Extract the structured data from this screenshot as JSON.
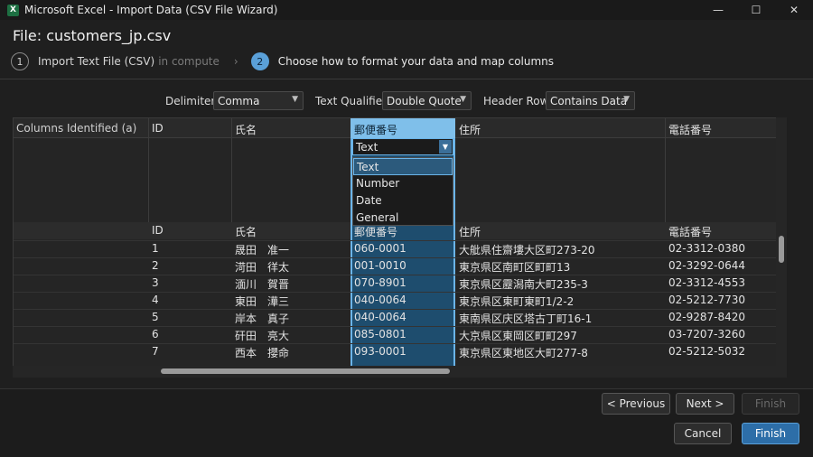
{
  "window": {
    "app_icon_letter": "X",
    "title": "Microsoft Excel - Import Data (CSV File Wizard)",
    "controls": {
      "minimize": "—",
      "maximize": "☐",
      "close": "✕"
    }
  },
  "file": {
    "title": "File: customers_jp.csv"
  },
  "steps": [
    {
      "num": "1",
      "label": "Import Text File (CSV)",
      "sub": "in compute",
      "active": false
    },
    {
      "num": "2",
      "label": "Choose how to format your data and map columns",
      "active": true
    }
  ],
  "step_separator": "›",
  "options": {
    "delimiter_label": "Delimiter:",
    "delimiter_value": "Comma",
    "qualifier_label": "Text Qualifier:",
    "qualifier_value": "Double Quote",
    "header_label": "Header Row:",
    "header_value": "Contains Data"
  },
  "grid": {
    "corner_label": "Columns Identified (a)",
    "columns": [
      "ID",
      "氏名",
      "郵便番号",
      "住所",
      "電話番号"
    ],
    "type_select_value": "Text",
    "type_options": [
      "Text",
      "Number",
      "Date",
      "General"
    ],
    "type_selected": "Text",
    "data_headers": [
      "ID",
      "氏名",
      "郵便番号",
      "住所",
      "電話番号"
    ],
    "rows": [
      [
        "1",
        "晟田　准一",
        "060-0001",
        "大舭県住齋塿大区町273-20",
        "02-3312-0380"
      ],
      [
        "2",
        "渮田　徉太",
        "001-0010",
        "東京県区南町区町町13",
        "02-3292-0644"
      ],
      [
        "3",
        "湎川　賀晋",
        "070-8901",
        "東京県区靂潟南大町235-3",
        "02-3312-4553"
      ],
      [
        "4",
        "東田　澕三",
        "040-0064",
        "東京県区東町東町1/2-2",
        "02-5212-7730"
      ],
      [
        "5",
        "岸本　真子",
        "040-0064",
        "東南県区庆区塔古丁町16-1",
        "02-9287-8420"
      ],
      [
        "6",
        "矸田　亮大",
        "085-0801",
        "大京県区東岡区町町297",
        "03-7207-3260"
      ],
      [
        "7",
        "西本　攖命",
        "093-0001",
        "東京県区東地区大町277-8",
        "02-5212-5032"
      ]
    ]
  },
  "buttons": {
    "previous": "< Previous",
    "next": "Next >",
    "finish_disabled": "Finish",
    "cancel": "Cancel",
    "finish": "Finish"
  }
}
